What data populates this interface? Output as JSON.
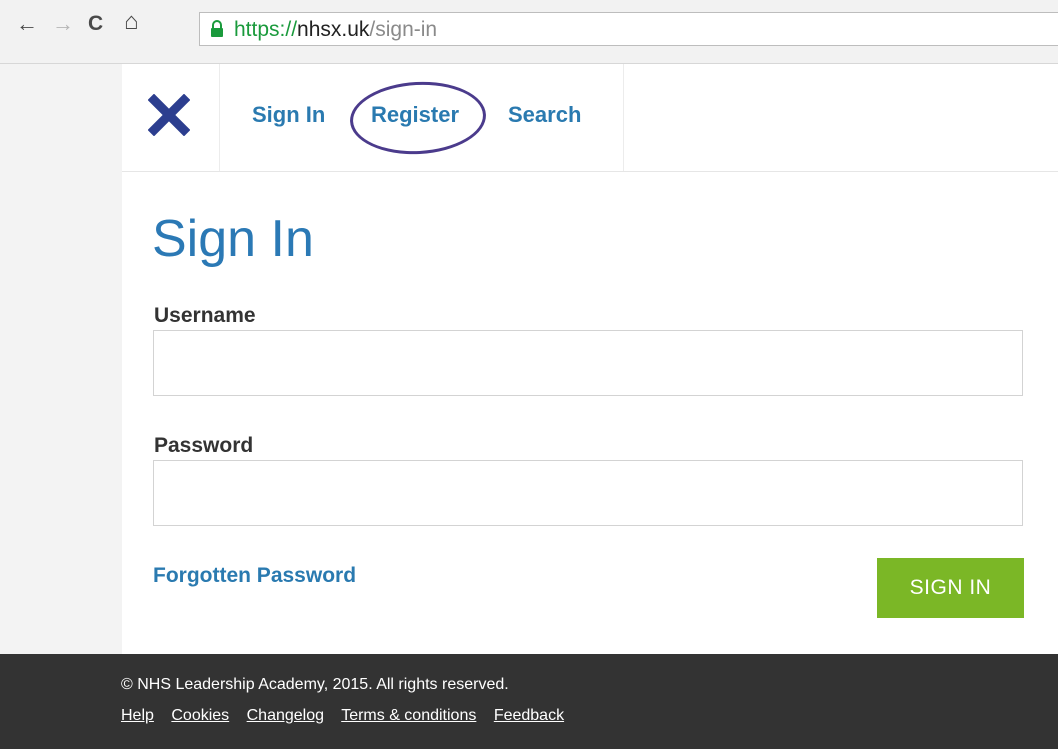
{
  "browser": {
    "url_scheme": "https://",
    "url_host": "nhsx.uk",
    "url_path": "/sign-in",
    "back_glyph": "←",
    "forward_glyph": "→",
    "reload_glyph": "C",
    "home_glyph": "⌂"
  },
  "header": {
    "nav": [
      "Sign In",
      "Register",
      "Search"
    ],
    "logo_color": "#2c3e8f"
  },
  "form": {
    "title": "Sign In",
    "username_label": "Username",
    "username_value": "",
    "password_label": "Password",
    "password_value": "",
    "forgot_link": "Forgotten Password",
    "submit_label": "SIGN IN"
  },
  "footer": {
    "copyright": "© NHS Leadership Academy, 2015. All rights reserved.",
    "links": [
      "Help",
      "Cookies",
      "Changelog",
      "Terms & conditions",
      "Feedback"
    ]
  },
  "colors": {
    "link_blue": "#2a7ab0",
    "button_green": "#7bb726",
    "annotation_circle": "#4b3b8c",
    "footer_bg": "#333333"
  }
}
